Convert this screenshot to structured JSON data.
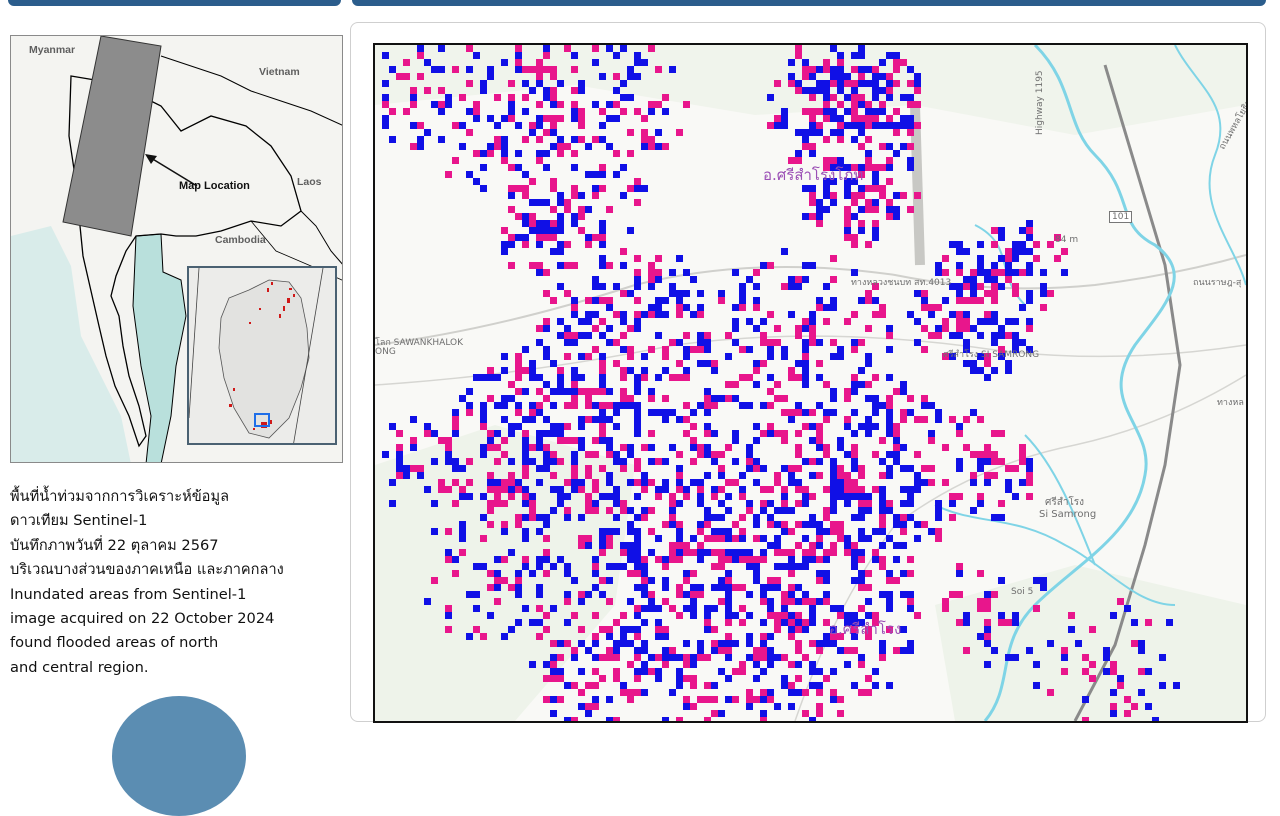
{
  "locator": {
    "labels": {
      "myanmar": "Myanmar",
      "vietnam": "Vietnam",
      "map_location": "Map Location",
      "laos": "Laos",
      "cambodia": "Cambodia"
    }
  },
  "description": {
    "lines": [
      "พื้นที่น้ำท่วมจากการวิเคราะห์ข้อมูล",
      "ดาวเทียม Sentinel-1",
      "บันทึกภาพวันที่ 22 ตุลาคม 2567",
      "บริเวณบางส่วนของภาคเหนือ และภาคกลาง",
      "Inundated areas from Sentinel-1",
      "image acquired on 22 October 2024",
      "found flooded areas of north",
      "and central region."
    ]
  },
  "main_map": {
    "labels": {
      "town_north": "อ.ศรีสำโรงโภท",
      "road_1": "ทางหลวงชนบท สท.4013",
      "road_2": "ศรีสำโรง SI SAMRONG",
      "sawankhalok": "โลก SAWANKHALOK",
      "ong": "ONG",
      "highway_1195": "Highway 1195",
      "si_samrong_th": "ศรีสำโรง",
      "si_samrong_en": "Si Samrong",
      "soi5": "Soi 5",
      "town_south": "อ.ศรีสำโรง",
      "route_101": "101",
      "elev_84": "84 m",
      "road_right_1": "ถนนพหลโยธิน",
      "road_right_2": "ถนนราษฎ-สุ",
      "road_right_3": "ทางหล"
    }
  },
  "colors": {
    "flood_blue": "#1010e6",
    "flood_magenta": "#e8168c",
    "river": "#7fd4e6",
    "sea": "#b9e0dc",
    "frame_bar": "#2b5d8c"
  }
}
